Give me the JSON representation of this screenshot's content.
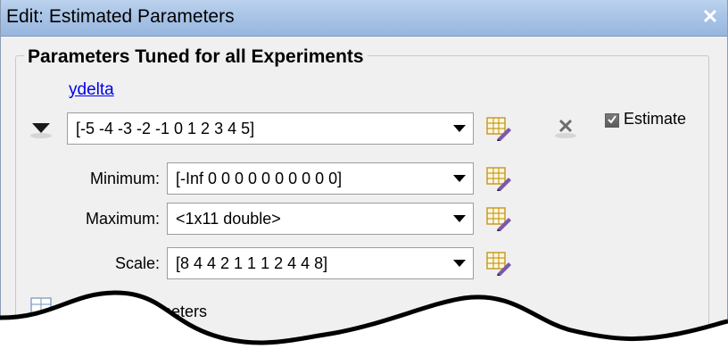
{
  "window": {
    "title": "Edit: Estimated Parameters",
    "close_glyph": "✕"
  },
  "panel": {
    "title": "Parameters Tuned for all Experiments"
  },
  "parameter": {
    "name": "ydelta",
    "value": "[-5 -4 -3 -2 -1 0 1 2 3 4 5]",
    "estimate_label": "Estimate",
    "estimate_checked": true,
    "rows": [
      {
        "label": "Minimum:",
        "value": "[-Inf 0 0 0 0 0 0 0 0 0 0]"
      },
      {
        "label": "Maximum:",
        "value": "<1x11 double>"
      },
      {
        "label": "Scale:",
        "value": "[8 4 4 2 1 1 1 2 4 4 8]"
      }
    ]
  },
  "bottom": {
    "partial_text": "meters"
  },
  "icons": {
    "collapse": "triangle-down-icon",
    "edit": "table-edit-icon",
    "delete": "x-delete-icon",
    "add": "table-icon"
  }
}
